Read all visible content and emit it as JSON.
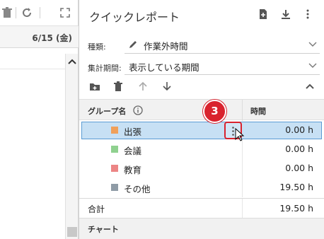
{
  "calendar": {
    "date_header": "6/15 (金)",
    "toolbar_icons": [
      "trash-icon",
      "refresh-icon",
      "expand-icon"
    ]
  },
  "panel": {
    "title": "クイックレポート",
    "header_icons": [
      "new-report-icon",
      "download-icon",
      "more-vertical-icon"
    ],
    "type_label": "種類:",
    "type_value": "作業外時間",
    "period_label": "集計期間:",
    "period_value": "表示している期間",
    "action_icons": [
      "add-folder-icon",
      "trash-icon",
      "arrow-up-icon",
      "arrow-down-icon",
      "collapse-icon"
    ],
    "table": {
      "col_group": "グループ名",
      "col_time": "時間",
      "rows": [
        {
          "label": "出張",
          "value": "0.00 h",
          "color": "#f0a05a"
        },
        {
          "label": "会議",
          "value": "0.00 h",
          "color": "#8fd18f"
        },
        {
          "label": "教育",
          "value": "0.00 h",
          "color": "#ec8585"
        },
        {
          "label": "その他",
          "value": "19.50 h",
          "color": "#8f9ba6"
        }
      ],
      "total_label": "合計",
      "total_value": "19.50 h"
    },
    "chart_section_label": "チャート"
  },
  "annotation": {
    "step_number": "3"
  }
}
